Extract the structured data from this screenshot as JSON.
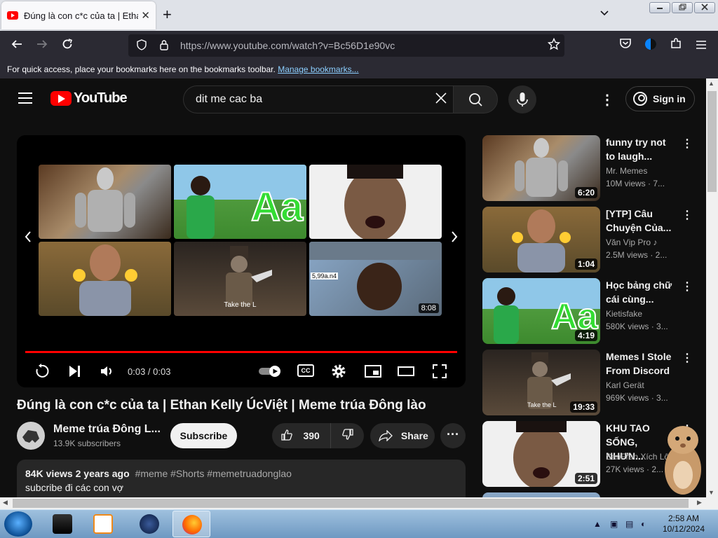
{
  "browser": {
    "tab_title": "Đúng là con c*c của ta | Ethan Kelly ÚcViệt | Meme trúa Đông lào",
    "tab_close": "✕",
    "new_tab": "+",
    "url": "https://www.youtube.com/watch?v=Bc56D1e90vc",
    "bookmark_text": "For quick access, place your bookmarks here on the bookmarks toolbar.",
    "bookmark_link": "Manage bookmarks..."
  },
  "youtube": {
    "logo_text": "YouTube",
    "search_query": "dit me cac ba",
    "sign_in": "Sign in"
  },
  "player": {
    "time": "0:03 / 0:03",
    "cc": "CC",
    "progress_percent": 100,
    "end_screen": [
      {
        "label": ""
      },
      {
        "label": ""
      },
      {
        "label": ""
      },
      {
        "label": ""
      },
      {
        "caption": "Take the L"
      },
      {
        "label": "8:08",
        "overlay_text": "5,99a.n4"
      }
    ]
  },
  "video": {
    "title": "Đúng là con c*c của ta | Ethan Kelly ÚcViệt | Meme trúa Đông lào",
    "channel_name": "Meme trúa Đông L...",
    "subscribers": "13.9K subscribers",
    "subscribe_label": "Subscribe",
    "likes": "390",
    "share_label": "Share",
    "views": "84K views",
    "age": "2 years ago",
    "tags": "#meme #Shorts #memetruadonglao",
    "description": "subcribe đi các con vợ"
  },
  "recommendations": [
    {
      "title": "funny try not to laugh...",
      "channel": "Mr. Memes",
      "views": "10M views · 7...",
      "duration": "6:20"
    },
    {
      "title": "[YTP] Câu Chuyện Của...",
      "channel": "Văn Vịp Pro",
      "views": "2.5M views · 2...",
      "duration": "1:04"
    },
    {
      "title": "Học bảng chữ cái cùng...",
      "channel": "Kietisfake",
      "views": "580K views · 3...",
      "duration": "4:19"
    },
    {
      "title": "Memes I Stole From Discord",
      "channel": "Karl Gerät",
      "views": "969K views · 3...",
      "duration": "19:33",
      "caption": "Take the L"
    },
    {
      "title": "KHU TAO SỐNG, NHƯN...",
      "channel": "SanFran Xích Lô",
      "views": "27K views · 2...",
      "duration": "2:51"
    }
  ],
  "taskbar": {
    "time": "2:58 AM",
    "date": "10/12/2024"
  },
  "icons": {
    "back": "back-arrow-icon",
    "forward": "forward-arrow-icon",
    "reload": "reload-icon",
    "bookmark_star": "star-icon",
    "replay": "replay-icon",
    "next": "next-icon",
    "volume": "volume-icon",
    "settings": "gear-icon",
    "miniplayer": "miniplayer-icon",
    "theater": "theater-icon",
    "fullscreen": "fullscreen-icon"
  },
  "colors": {
    "youtube_red": "#ff0000",
    "background": "#0f0f0f",
    "browser_toolbar": "#2b2a33"
  }
}
